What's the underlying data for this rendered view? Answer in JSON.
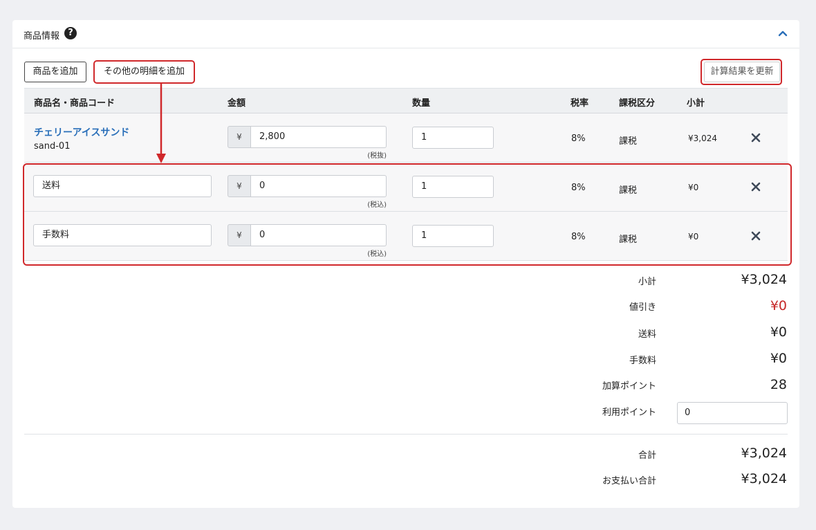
{
  "section": {
    "title": "商品情報",
    "help_icon": "?"
  },
  "toolbar": {
    "add_product": "商品を追加",
    "add_other": "その他の明細を追加",
    "recalculate": "計算結果を更新"
  },
  "table": {
    "headers": [
      "商品名・商品コード",
      "金額",
      "数量",
      "税率",
      "課税区分",
      "小計"
    ],
    "rows": [
      {
        "name": "チェリーアイスサンド",
        "code": "sand-01",
        "currency": "¥",
        "price": "2,800",
        "tax_note": "(税抜)",
        "qty": "1",
        "rate": "8%",
        "tax_type": "課税",
        "subtotal": "¥3,024"
      },
      {
        "name": "送料",
        "currency": "¥",
        "price": "0",
        "tax_note": "(税込)",
        "qty": "1",
        "rate": "8%",
        "tax_type": "課税",
        "subtotal": "¥0"
      },
      {
        "name": "手数料",
        "currency": "¥",
        "price": "0",
        "tax_note": "(税込)",
        "qty": "1",
        "rate": "8%",
        "tax_type": "課税",
        "subtotal": "¥0"
      }
    ]
  },
  "summary": {
    "subtotal_label": "小計",
    "subtotal": "¥3,024",
    "discount_label": "値引き",
    "discount": "¥0",
    "shipping_label": "送料",
    "shipping": "¥0",
    "fee_label": "手数料",
    "fee": "¥0",
    "add_points_label": "加算ポイント",
    "add_points": "28",
    "use_points_label": "利用ポイント",
    "use_points": "0",
    "total_label": "合計",
    "total": "¥3,024",
    "payment_total_label": "お支払い合計",
    "payment_total": "¥3,024"
  },
  "colors": {
    "accent": "#2a6fb9",
    "highlight": "#d0282b",
    "discount": "#c62828"
  }
}
